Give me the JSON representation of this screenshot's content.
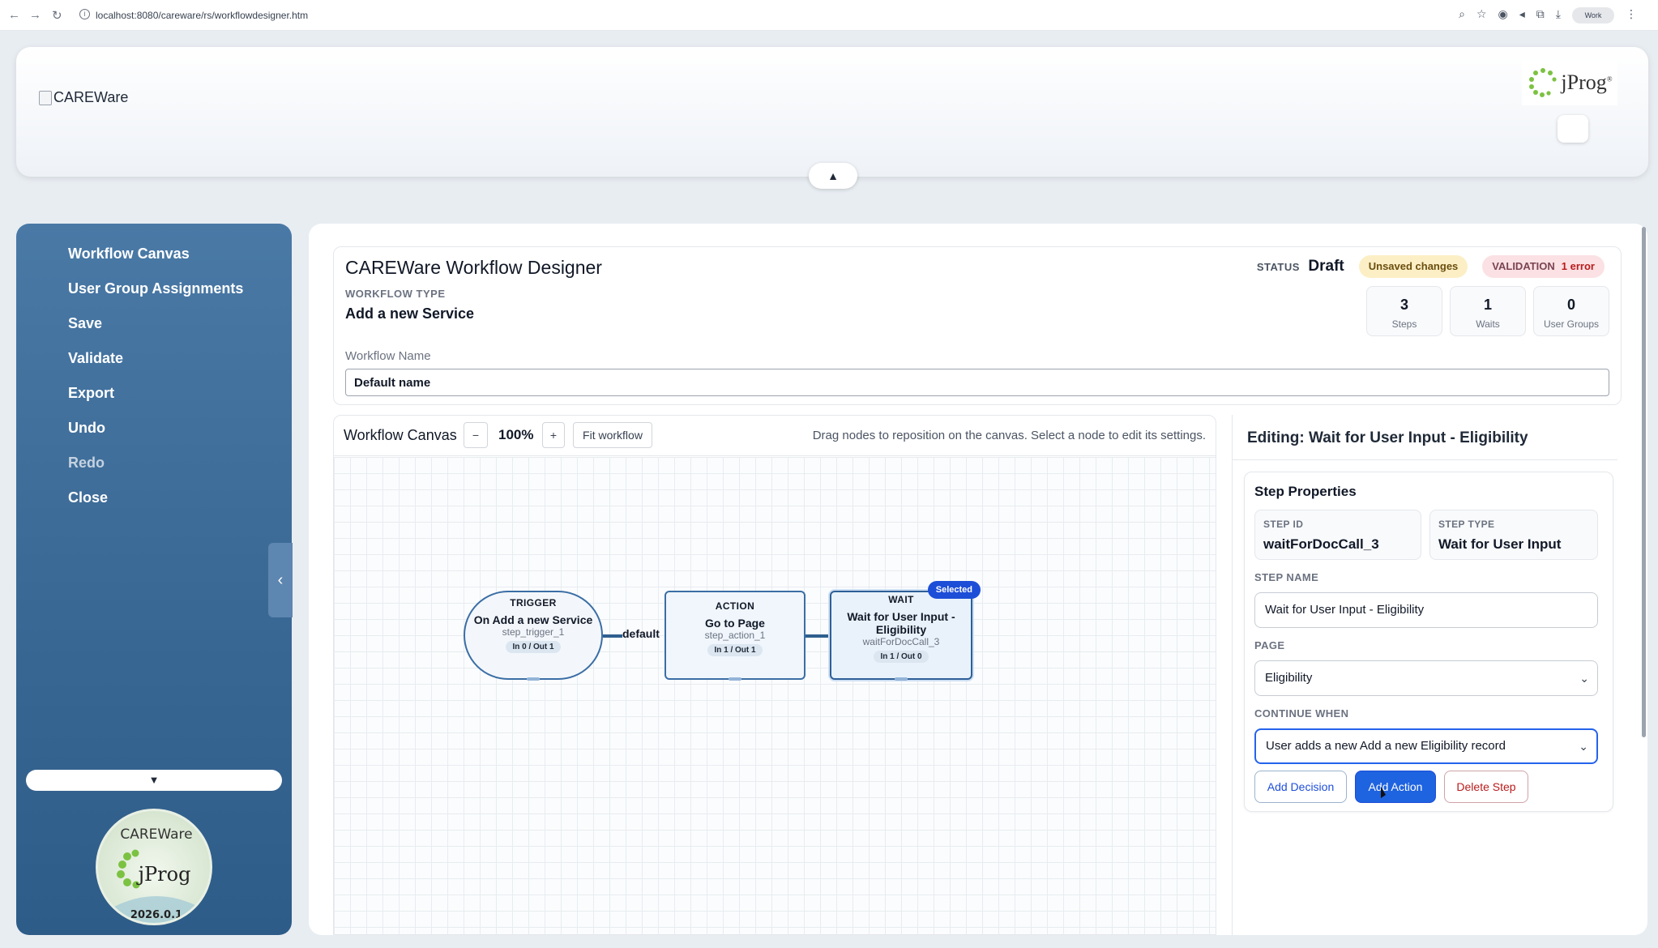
{
  "browser": {
    "url": "localhost:8080/careware/rs/workflowdesigner.htm",
    "profile_label": "Work"
  },
  "header": {
    "brand_alt": "CAREWare",
    "logo_text": "jProg",
    "logo_reg": "®"
  },
  "sidebar": {
    "items": [
      {
        "label": "Workflow Canvas",
        "enabled": true
      },
      {
        "label": "User Group Assignments",
        "enabled": true
      },
      {
        "label": "Save",
        "enabled": true
      },
      {
        "label": "Validate",
        "enabled": true
      },
      {
        "label": "Export",
        "enabled": true
      },
      {
        "label": "Undo",
        "enabled": true
      },
      {
        "label": "Redo",
        "enabled": false
      },
      {
        "label": "Close",
        "enabled": true
      }
    ],
    "seal": {
      "top_text": "CAREWare",
      "logo_text": "jProg",
      "version": "2026.0.1"
    }
  },
  "summary": {
    "title": "CAREWare Workflow Designer",
    "workflow_type_label": "WORKFLOW TYPE",
    "workflow_type_value": "Add a new Service",
    "status_label": "STATUS",
    "status_value": "Draft",
    "unsaved_label": "Unsaved changes",
    "validation_label": "VALIDATION",
    "validation_value": "1 error",
    "stats": [
      {
        "value": "3",
        "label": "Steps"
      },
      {
        "value": "1",
        "label": "Waits"
      },
      {
        "value": "0",
        "label": "User Groups"
      }
    ],
    "workflow_name_label": "Workflow Name",
    "workflow_name_value": "Default name"
  },
  "canvas": {
    "title": "Workflow Canvas",
    "zoom_out": "−",
    "zoom_value": "100%",
    "zoom_in": "+",
    "fit_label": "Fit workflow",
    "hint": "Drag nodes to reposition on the canvas. Select a node to edit its settings.",
    "nodes": [
      {
        "kind": "TRIGGER",
        "title": "On Add a new Service",
        "step_id": "step_trigger_1",
        "io": "In 0 / Out 1"
      },
      {
        "kind": "ACTION",
        "title": "Go to Page",
        "step_id": "step_action_1",
        "io": "In 1 / Out 1"
      },
      {
        "kind": "WAIT",
        "title": "Wait for User Input - Eligibility",
        "step_id": "waitForDocCall_3",
        "io": "In 1 / Out 0",
        "badge": "Selected"
      }
    ],
    "edge_label": "default"
  },
  "editor": {
    "title": "Editing: Wait for User Input - Eligibility",
    "props_title": "Step Properties",
    "step_id_label": "STEP ID",
    "step_id_value": "waitForDocCall_3",
    "step_type_label": "STEP TYPE",
    "step_type_value": "Wait for User Input",
    "step_name_label": "STEP NAME",
    "step_name_value": "Wait for User Input - Eligibility",
    "page_label": "PAGE",
    "page_value": "Eligibility",
    "continue_label": "CONTINUE WHEN",
    "continue_value": "User adds a new Add a new Eligibility record",
    "buttons": {
      "add_decision": "Add Decision",
      "add_action": "Add Action",
      "delete_step": "Delete Step"
    }
  },
  "colors": {
    "sidebar": "#3a6894",
    "node_border": "#3b6ea5",
    "primary": "#1e63e0",
    "selected_badge": "#1d4ed8"
  }
}
